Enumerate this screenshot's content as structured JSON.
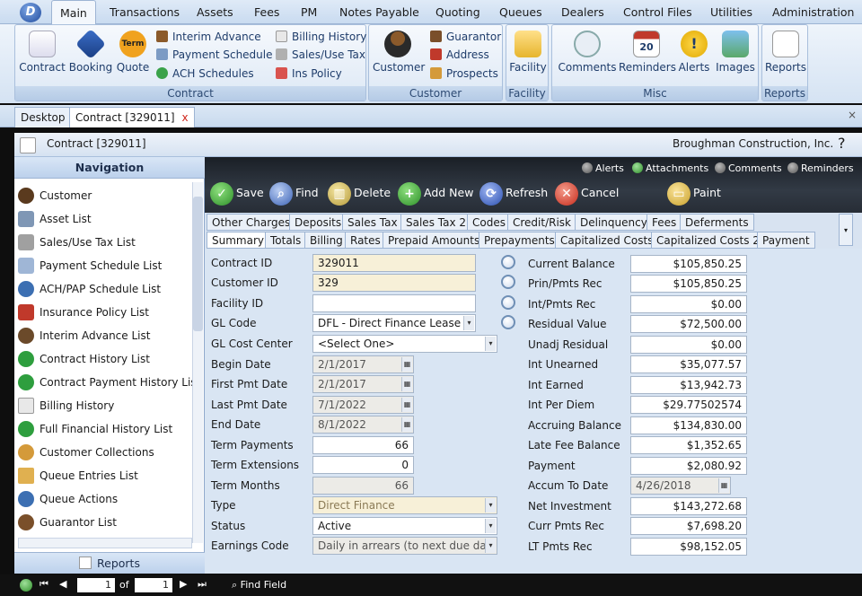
{
  "menu": [
    "Main",
    "Transactions",
    "Assets",
    "Fees",
    "PM",
    "Notes Payable",
    "Quoting",
    "Queues",
    "Dealers",
    "Control Files",
    "Utilities",
    "Administration"
  ],
  "app_logo_letter": "D",
  "ribbon": {
    "contract_group": {
      "label": "Contract",
      "big_buttons": [
        "Contract",
        "Booking",
        "Quote"
      ],
      "quote_icon_text": "Term",
      "small_col1": [
        "Interim Advance",
        "Payment Schedule",
        "ACH Schedules"
      ],
      "small_col2": [
        "Billing History",
        "Sales/Use Tax",
        "Ins Policy"
      ]
    },
    "customer_group": {
      "label": "Customer",
      "big_buttons": [
        "Customer"
      ],
      "small": [
        "Guarantor",
        "Address",
        "Prospects"
      ]
    },
    "facility_group": {
      "label": "Facility",
      "big_buttons": [
        "Facility"
      ]
    },
    "misc_group": {
      "label": "Misc",
      "big_buttons": [
        "Comments",
        "Reminders",
        "Alerts",
        "Images"
      ],
      "reminder_day": "20"
    },
    "reports_group": {
      "label": "Reports",
      "big_buttons": [
        "Reports"
      ]
    }
  },
  "doc_tabs": {
    "desktop": "Desktop",
    "contract": "Contract [329011]",
    "close": "x",
    "strip_close": "×"
  },
  "titlebar": {
    "title": "Contract [329011]",
    "company": "Broughman Construction, Inc.",
    "help": "?"
  },
  "navigation": {
    "header": "Navigation",
    "items": [
      "Customer",
      "Asset List",
      "Sales/Use Tax List",
      "Payment Schedule List",
      "ACH/PAP Schedule List",
      "Insurance Policy List",
      "Interim Advance List",
      "Contract History List",
      "Contract Payment History List",
      "Billing History",
      "Full Financial History List",
      "Customer Collections",
      "Queue Entries List",
      "Queue Actions",
      "Guarantor List"
    ],
    "footer": "Reports"
  },
  "toolbar": {
    "buttons": [
      "Save",
      "Find",
      "Delete",
      "Add New",
      "Refresh",
      "Cancel",
      "Paint"
    ],
    "checks": [
      "Alerts",
      "Attachments",
      "Comments",
      "Reminders"
    ]
  },
  "tabs_row1": [
    "Other Charges",
    "Deposits",
    "Sales Tax",
    "Sales Tax 2",
    "Codes",
    "Credit/Risk",
    "Delinquency",
    "Fees",
    "Deferments"
  ],
  "tabs_row2": [
    "Summary",
    "Totals",
    "Billing",
    "Rates",
    "Prepaid Amounts",
    "Prepayments",
    "Capitalized Costs",
    "Capitalized Costs 2",
    "Payment"
  ],
  "left_fields": [
    {
      "label": "Contract ID",
      "value": "329011"
    },
    {
      "label": "Customer ID",
      "value": "329"
    },
    {
      "label": "Facility ID",
      "value": ""
    },
    {
      "label": "GL Code",
      "value": "DFL - Direct Finance Lease"
    },
    {
      "label": "GL Cost Center",
      "value": "<Select One>"
    },
    {
      "label": "Begin Date",
      "value": "2/1/2017"
    },
    {
      "label": "First Pmt Date",
      "value": "2/1/2017"
    },
    {
      "label": "Last Pmt Date",
      "value": "7/1/2022"
    },
    {
      "label": "End Date",
      "value": "8/1/2022"
    },
    {
      "label": "Term Payments",
      "value": "66"
    },
    {
      "label": "Term Extensions",
      "value": "0"
    },
    {
      "label": "Term Months",
      "value": "66"
    },
    {
      "label": "Type",
      "value": "Direct Finance"
    },
    {
      "label": "Status",
      "value": "Active"
    },
    {
      "label": "Earnings Code",
      "value": "Daily in arrears (to next due dat"
    }
  ],
  "right_fields": [
    {
      "label": "Current Balance",
      "value": "$105,850.25"
    },
    {
      "label": "Prin/Pmts Rec",
      "value": "$105,850.25"
    },
    {
      "label": "Int/Pmts Rec",
      "value": "$0.00"
    },
    {
      "label": "Residual Value",
      "value": "$72,500.00"
    },
    {
      "label": "Unadj Residual",
      "value": "$0.00"
    },
    {
      "label": "Int Unearned",
      "value": "$35,077.57"
    },
    {
      "label": "Int Earned",
      "value": "$13,942.73"
    },
    {
      "label": "Int Per Diem",
      "value": "$29.77502574"
    },
    {
      "label": "Accruing Balance",
      "value": "$134,830.00"
    },
    {
      "label": "Late Fee Balance",
      "value": "$1,352.65"
    },
    {
      "label": "Payment",
      "value": "$2,080.92"
    },
    {
      "label": "Accum To Date",
      "value": "4/26/2018"
    },
    {
      "label": "Net Investment",
      "value": "$143,272.68"
    },
    {
      "label": "Curr Pmts Rec",
      "value": "$7,698.20"
    },
    {
      "label": "LT Pmts Rec",
      "value": "$98,152.05"
    }
  ],
  "pager": {
    "page": "1",
    "of_label": "of",
    "total": "1",
    "find_field": "Find Field"
  },
  "colors": {
    "toolbar_bg": "#272d36",
    "form_bg": "#d9e5f3",
    "readonly_field": "#f7f0d8",
    "accent": "#1f4a9c"
  }
}
